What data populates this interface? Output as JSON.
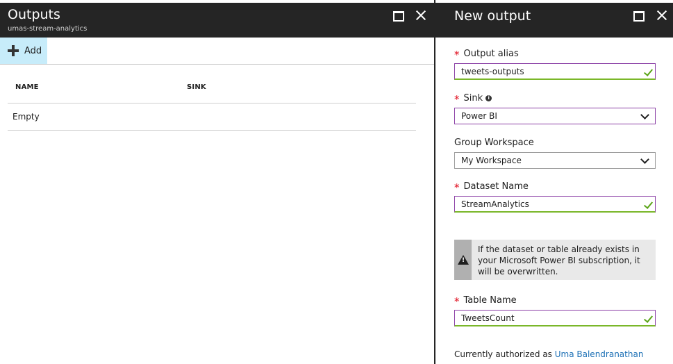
{
  "outputs_blade": {
    "title": "Outputs",
    "subtitle": "umas-stream-analytics",
    "add_label": "Add",
    "columns": [
      "NAME",
      "SINK"
    ],
    "empty_text": "Empty"
  },
  "new_output_blade": {
    "title": "New output",
    "fields": {
      "output_alias": {
        "label": "Output alias",
        "value": "tweets-outputs"
      },
      "sink": {
        "label": "Sink",
        "value": "Power BI"
      },
      "group_workspace": {
        "label": "Group Workspace",
        "value": "My Workspace"
      },
      "dataset_name": {
        "label": "Dataset Name",
        "value": "StreamAnalytics"
      },
      "table_name": {
        "label": "Table Name",
        "value": "TweetsCount"
      }
    },
    "warning_text": "If the dataset or table already exists in your Microsoft Power BI subscription, it will be overwritten.",
    "authorized_prefix": "Currently authorized as",
    "authorized_user": "Uma Balendranathan"
  },
  "icons": {
    "maximize": "maximize-icon",
    "close": "close-icon",
    "add": "plus-icon",
    "valid": "checkmark-icon",
    "dropdown": "chevron-down-icon",
    "info": "info-icon",
    "warning": "warning-icon"
  },
  "colors": {
    "header_bg": "#252525",
    "add_button_bg": "#c7ecfa",
    "focus_border": "#8a3ea5",
    "valid_green": "#7ab729",
    "required_red": "#e00b1c",
    "link_blue": "#1b6fb5"
  }
}
